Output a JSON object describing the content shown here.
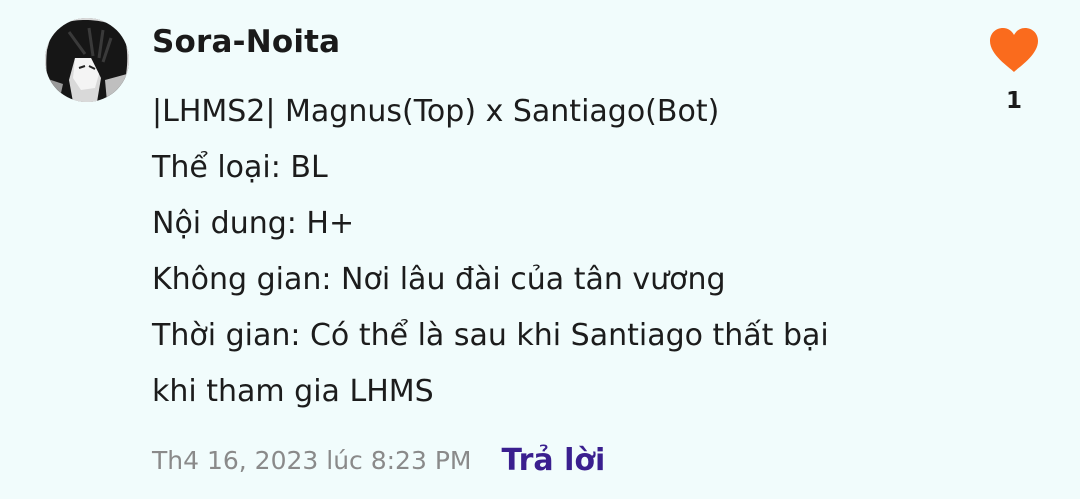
{
  "comment": {
    "username": "Sora-Noita",
    "lines": [
      "|LHMS2| Magnus(Top) x Santiago(Bot)",
      "Thể loại: BL",
      "Nội dung: H+",
      "Không gian: Nơi lâu đài của tân vương",
      "Thời gian: Có thể là sau khi Santiago thất bại",
      "khi tham gia LHMS"
    ],
    "timestamp": "Th4 16, 2023 lúc 8:23 PM",
    "reply_label": "Trả lời",
    "like_count": "1"
  },
  "colors": {
    "background": "#f1fcfc",
    "heart": "#fa6b1d",
    "reply": "#3a1f8f",
    "timestamp": "#8a8a8a"
  },
  "icons": {
    "avatar": "avatar",
    "like": "heart-icon"
  }
}
